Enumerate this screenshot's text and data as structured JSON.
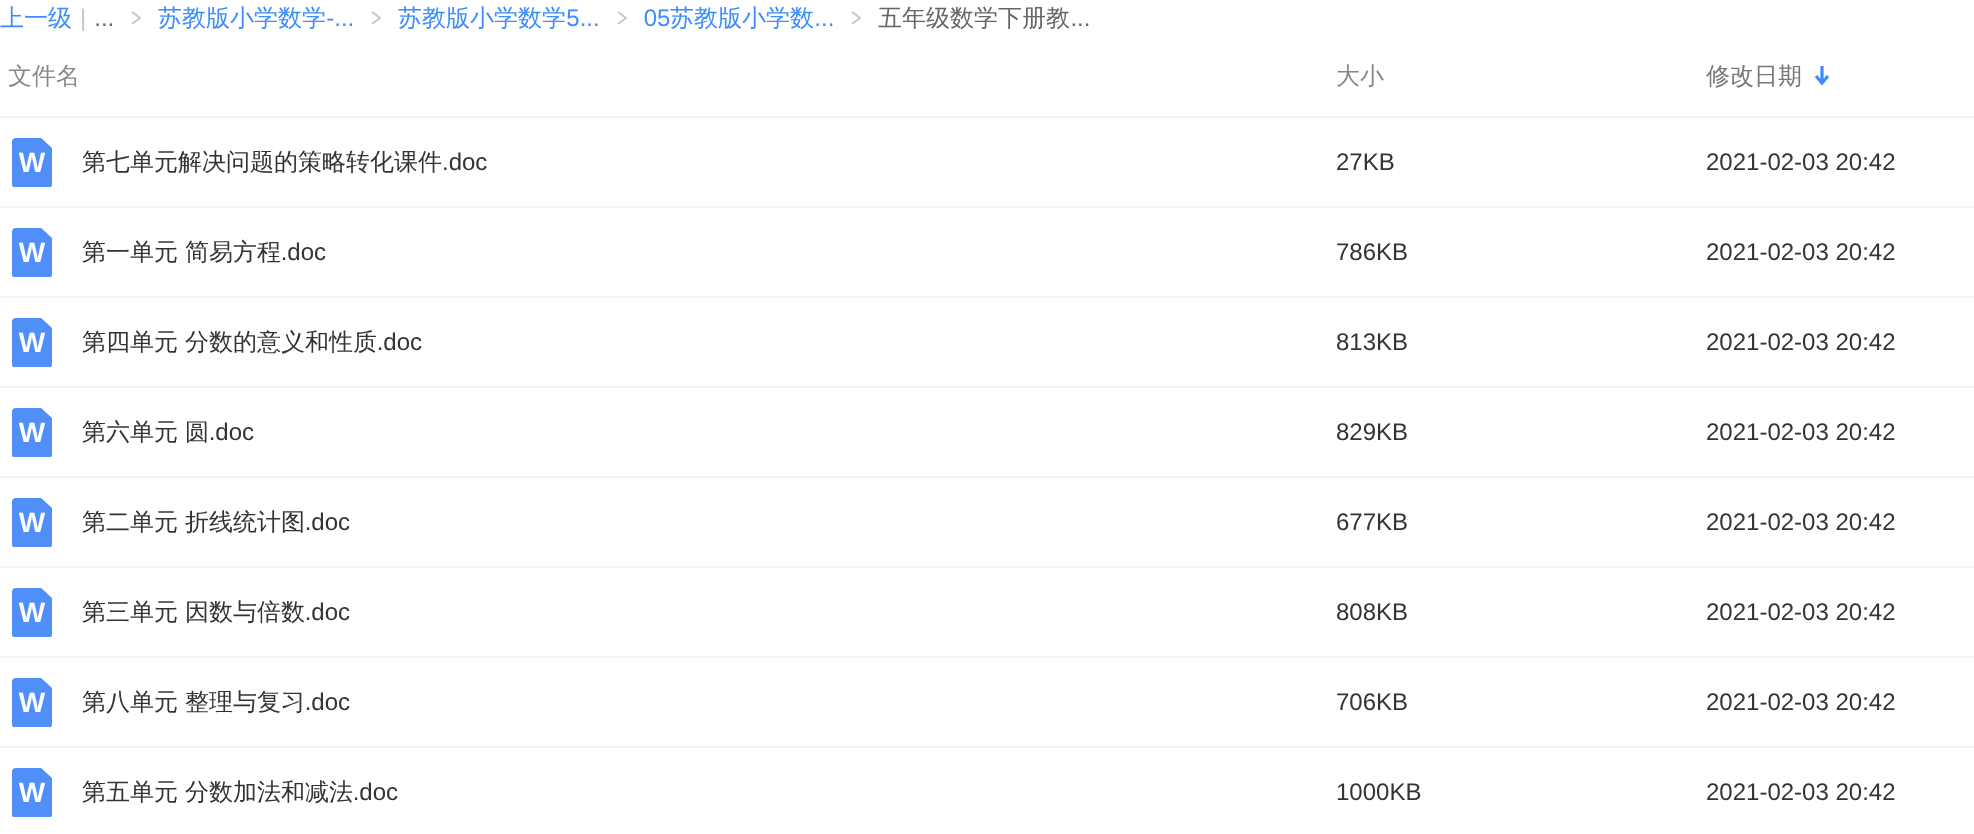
{
  "breadcrumb": {
    "back": "上一级",
    "divider": "|",
    "ellipsis": "...",
    "items": [
      {
        "label": "苏教版小学数学-...",
        "kind": "link"
      },
      {
        "label": "苏教版小学数学5...",
        "kind": "link"
      },
      {
        "label": "05苏教版小学数...",
        "kind": "link"
      },
      {
        "label": "五年级数学下册教...",
        "kind": "current"
      }
    ]
  },
  "table": {
    "columns": [
      {
        "label": "文件名",
        "sorted": false
      },
      {
        "label": "大小",
        "sorted": false
      },
      {
        "label": "修改日期",
        "sorted": true
      }
    ],
    "rows": [
      {
        "icon": "W",
        "name": "第七单元解决问题的策略转化课件.doc",
        "size": "27KB",
        "date": "2021-02-03 20:42"
      },
      {
        "icon": "W",
        "name": "第一单元 简易方程.doc",
        "size": "786KB",
        "date": "2021-02-03 20:42"
      },
      {
        "icon": "W",
        "name": "第四单元 分数的意义和性质.doc",
        "size": "813KB",
        "date": "2021-02-03 20:42"
      },
      {
        "icon": "W",
        "name": "第六单元 圆.doc",
        "size": "829KB",
        "date": "2021-02-03 20:42"
      },
      {
        "icon": "W",
        "name": "第二单元 折线统计图.doc",
        "size": "677KB",
        "date": "2021-02-03 20:42"
      },
      {
        "icon": "W",
        "name": "第三单元 因数与倍数.doc",
        "size": "808KB",
        "date": "2021-02-03 20:42"
      },
      {
        "icon": "W",
        "name": "第八单元 整理与复习.doc",
        "size": "706KB",
        "date": "2021-02-03 20:42"
      },
      {
        "icon": "W",
        "name": "第五单元 分数加法和减法.doc",
        "size": "1000KB",
        "date": "2021-02-03 20:42"
      }
    ]
  }
}
